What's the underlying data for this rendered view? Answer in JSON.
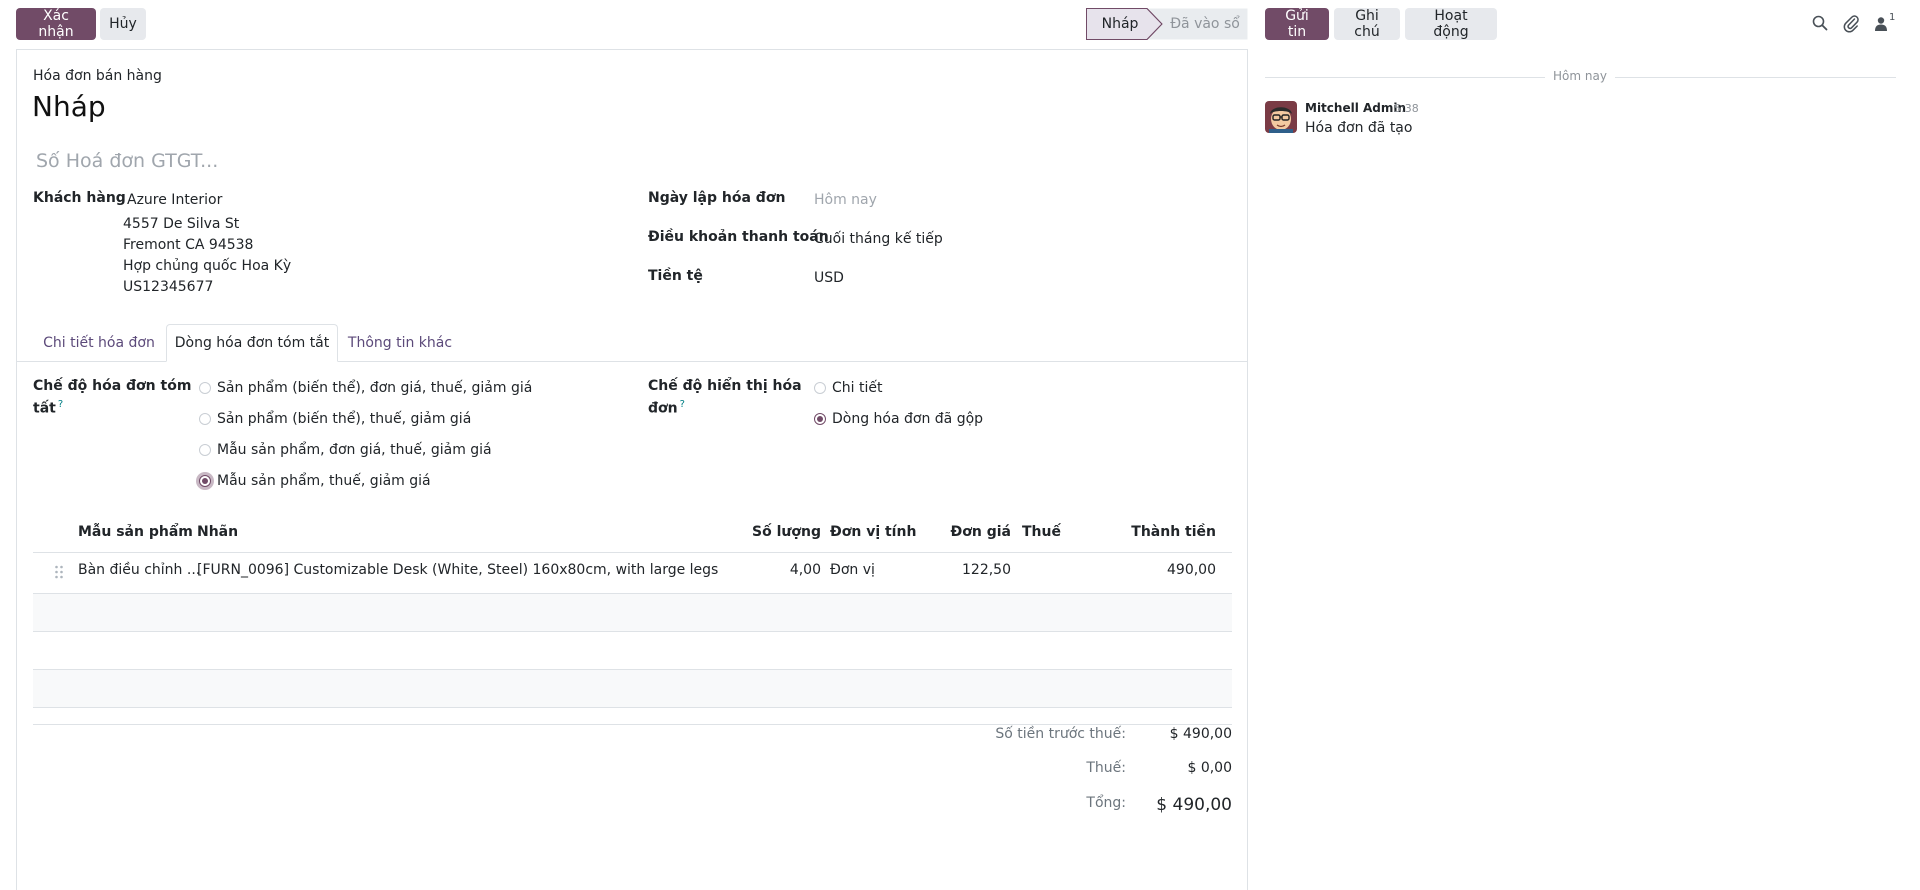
{
  "toolbar": {
    "confirm_label": "Xác nhận",
    "cancel_label": "Hủy"
  },
  "statusbar": {
    "steps": [
      "Nháp",
      "Đã vào sổ"
    ],
    "active": "Nháp"
  },
  "chatter": {
    "send_label": "Gửi tin",
    "note_label": "Ghi chú",
    "activity_label": "Hoạt động",
    "follower_count": "1",
    "date_separator": "Hôm nay",
    "message": {
      "author": "Mitchell Admin",
      "time": "5:38",
      "body": "Hóa đơn đã tạo"
    }
  },
  "form": {
    "doc_type": "Hóa đơn bán hàng",
    "title": "Nháp",
    "vat_placeholder": "Số Hoá đơn GTGT...",
    "customer_label": "Khách hàng",
    "customer_name": "Azure Interior",
    "customer_address": [
      "4557 De Silva St",
      "Fremont CA 94538",
      "Hợp chủng quốc Hoa Kỳ",
      "US12345677"
    ],
    "invoice_date_label": "Ngày lập hóa đơn",
    "invoice_date_placeholder": "Hôm nay",
    "payment_terms_label": "Điều khoản thanh toán",
    "payment_terms_value": "Cuối tháng kế tiếp",
    "currency_label": "Tiền tệ",
    "currency_value": "USD"
  },
  "tabs": [
    {
      "label": "Chi tiết hóa đơn",
      "active": false
    },
    {
      "label": "Dòng hóa đơn tóm tắt",
      "active": true
    },
    {
      "label": "Thông tin khác",
      "active": false
    }
  ],
  "summary_mode": {
    "label_line1": "Chế độ hóa đơn tóm",
    "label_line2": "tất",
    "help": "?",
    "options": [
      {
        "label": "Sản phẩm (biến thể), đơn giá, thuế, giảm giá",
        "checked": false
      },
      {
        "label": "Sản phẩm (biến thể), thuế, giảm giá",
        "checked": false
      },
      {
        "label": "Mẫu sản phẩm, đơn giá, thuế, giảm giá",
        "checked": false
      },
      {
        "label": "Mẫu sản phẩm, thuế, giảm giá",
        "checked": true
      }
    ]
  },
  "display_mode": {
    "label_line1": "Chế độ hiển thị hóa",
    "label_line2": "đơn",
    "help": "?",
    "options": [
      {
        "label": "Chi tiết",
        "checked": false
      },
      {
        "label": "Dòng hóa đơn đã gộp",
        "checked": true
      }
    ]
  },
  "table": {
    "headers": {
      "product_template": "Mẫu sản phẩm",
      "label": "Nhãn",
      "quantity": "Số lượng",
      "uom": "Đơn vị tính",
      "unit_price": "Đơn giá",
      "tax": "Thuế",
      "subtotal": "Thành tiền"
    },
    "rows": [
      {
        "product_template": "Bàn điều chỉnh ...",
        "label": "[FURN_0096] Customizable Desk (White, Steel) 160x80cm, with large legs",
        "quantity": "4,00",
        "uom": "Đơn vị",
        "unit_price": "122,50",
        "tax": "",
        "subtotal": "490,00"
      }
    ]
  },
  "totals": {
    "untaxed_label": "Số tiền trước thuế:",
    "untaxed_value": "$ 490,00",
    "tax_label": "Thuế:",
    "tax_value": "$ 0,00",
    "total_label": "Tổng:",
    "total_value": "$ 490,00"
  },
  "colors": {
    "primary": "#714b67",
    "secondary_bg": "#e7e9ed",
    "status_active_bg": "#e7e3ec",
    "muted_text": "#a0a6ad"
  }
}
